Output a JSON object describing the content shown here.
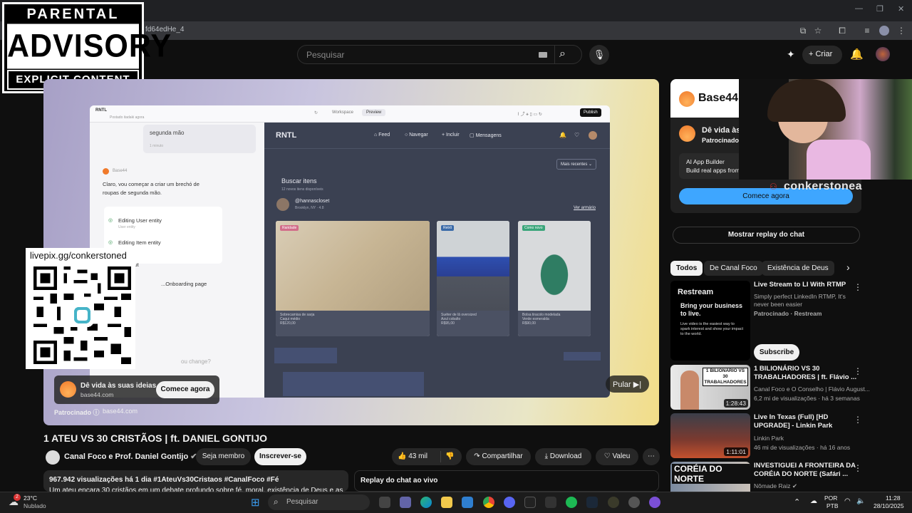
{
  "browser": {
    "url": "fd64edHe_4"
  },
  "overlay": {
    "parental_advisory": [
      "PARENTAL",
      "ADVISORY",
      "EXPLICIT CONTENT"
    ],
    "qr_label": "livepix.gg/conkerstoned",
    "streamer_name": "conkerstonea"
  },
  "header": {
    "search_placeholder": "Pesquisar",
    "create_label": "Criar"
  },
  "video_content": {
    "app_header": {
      "title": "RNTL",
      "subtitle": "Postado itadaki agora",
      "tab_workspace": "Workspace",
      "tab_preview": "Preview",
      "publish": "Publish"
    },
    "chat": {
      "bubble_text": "segunda mão",
      "bubble_time": "1 minuto",
      "sender": "Base44",
      "message": "Claro, vou começar a criar um brechó de roupas de segunda mão.",
      "steps": [
        "Editing User entity",
        "Editing Item entity",
        "...Layout",
        "...Onboarding page"
      ],
      "step_sub": "User entity",
      "question": "ou change?"
    },
    "rntl": {
      "logo": "RNTL",
      "nav": [
        "Feed",
        "Navegar",
        "Incluir",
        "Mensagens"
      ],
      "sort": "Mais recentes",
      "section_title": "Buscar itens",
      "section_sub": "12 novos itens disponíveis",
      "seller": "@hannascloset",
      "seller_loc": "Brooklyn, NY · 4.8",
      "see_all": "Ver armário",
      "items": [
        {
          "tag": "Raridade",
          "title": "Sobrecamisa de sarja",
          "sub": "Caqui médio",
          "price": "R$120,00"
        },
        {
          "tag": "Retrô",
          "title": "Suéter de lã oversized",
          "sub": "Azul cobalto",
          "price": "R$95,00"
        },
        {
          "tag": "Como novo",
          "title": "Bolsa tiracolo modelada",
          "sub": "Verde esmeralda",
          "price": "R$90,00"
        }
      ]
    },
    "ad": {
      "title": "Dê vida às suas ideias",
      "domain": "base44.com",
      "cta": "Comece agora",
      "sponsored": "Patrocinado",
      "sponsored_domain": "base44.com",
      "skip": "Pular"
    }
  },
  "video": {
    "title": "1 ATEU VS 30 CRISTÃOS | ft. DANIEL GONTIJO",
    "channel": "Canal Foco e Prof. Daniel Gontijo",
    "join": "Seja membro",
    "subscribe": "Inscrever-se",
    "likes": "43 mil",
    "share": "Compartilhar",
    "download": "Download",
    "thanks": "Valeu",
    "desc_stats": "967.942 visualizações  há 1 dia  #1AteuVs30Cristaos #CanalFoco #Fé",
    "desc_line2": "Um ateu encara 30 cristãos em um debate profundo sobre fé, moral, existência de Deus e as",
    "chat_replay": "Replay do chat ao vivo"
  },
  "sidebar": {
    "ad": {
      "brand": "Base44",
      "title": "Dê vida às",
      "sponsored": "Patrocinado",
      "line1": "AI App Builder",
      "line2": "Build real apps from",
      "cta": "Comece agora"
    },
    "chat_replay_btn": "Mostrar replay do chat",
    "chips": [
      "Todos",
      "De Canal Foco",
      "Existência de Deus"
    ],
    "recs": [
      {
        "title": "Live Stream to LI With RTMP",
        "line2": "Simply perfect LinkedIn RTMP, It's never been easier",
        "channel": "Patrocinado · Restream",
        "thumb_title": "Restream",
        "thumb_head": "Bring your business to live.",
        "thumb_body": "Live video is the easiest way to spark interest and show your impact to the world.",
        "cta": "Subscribe"
      },
      {
        "title": "1 BILIONÁRIO VS 30 TRABALHADORES | ft. Flávio ...",
        "channel": "Canal Foco e O Conselho | Flávio August...",
        "meta": "6,2 mi de visualizações · há 3 semanas",
        "duration": "1:28:43",
        "thumb_text": "1 BILIONÁRIO VS 30 TRABALHADORES"
      },
      {
        "title": "Live In Texas (Full) [HD UPGRADE] - Linkin Park",
        "channel": "Linkin Park",
        "meta": "46 mi de visualizações · há 16 anos",
        "duration": "1:11:01"
      },
      {
        "title": "INVESTIGUEI A FRONTEIRA DA CORÉIA DO NORTE (Safári ...",
        "channel": "Nômade Raiz",
        "thumb_text": "CORÉIA DO NORTE"
      }
    ]
  },
  "taskbar": {
    "weather_temp": "23°C",
    "weather_desc": "Nublado",
    "weather_badge": "2",
    "search": "Pesquisar",
    "lang1": "POR",
    "lang2": "PTB",
    "time": "11:28",
    "date": "28/10/2025"
  }
}
